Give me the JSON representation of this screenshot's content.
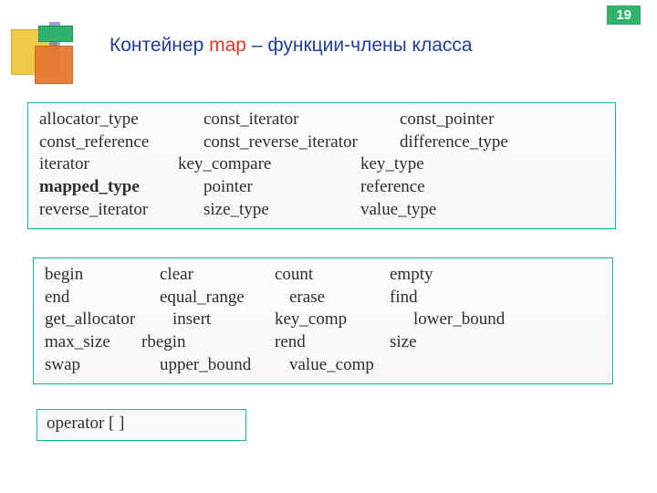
{
  "page_number": "19",
  "title": {
    "word1": "Контейнер",
    "word2": "map",
    "rest": " – функции-члены класса"
  },
  "box1": {
    "r1c1": "allocator_type",
    "r1c2": "const_iterator",
    "r1c3": "const_pointer",
    "r2c1": "const_reference",
    "r2c2": "const_reverse_iterator",
    "r2c3": "difference_type",
    "r3c1": "iterator",
    "r3c2": "key_compare",
    "r3c3": "key_type",
    "r4c1": "mapped_type",
    "r4c2": "pointer",
    "r4c3": "reference",
    "r5c1": "reverse_iterator",
    "r5c2": "size_type",
    "r5c3": "value_type"
  },
  "box2": {
    "r1c1": "begin",
    "r1c2": "clear",
    "r1c3": "count",
    "r1c4": "empty",
    "r2c1": "end",
    "r2c2": "equal_range",
    "r2c3": "erase",
    "r2c4": "find",
    "r3c1": "get_allocator",
    "r3c2": "insert",
    "r3c3": "key_comp",
    "r3c4": "lower_bound",
    "r4c1": "max_size",
    "r4c2": "rbegin",
    "r4c3": "rend",
    "r4c4": "size",
    "r5c1": "swap",
    "r5c2": "upper_bound",
    "r5c3": "value_comp"
  },
  "box3": {
    "text": "operator [ ]"
  }
}
